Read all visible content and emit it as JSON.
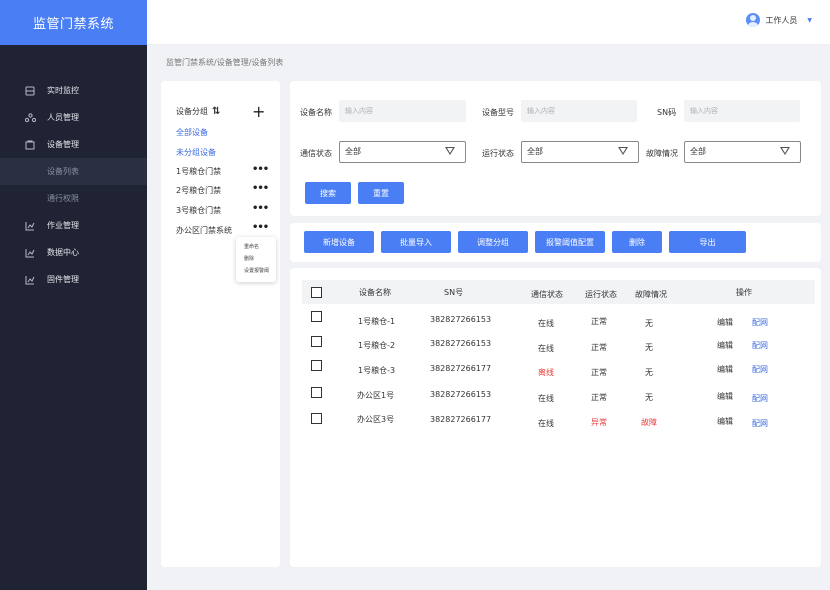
{
  "brand": "监管门禁系统",
  "user": {
    "name": "工作人员"
  },
  "breadcrumb": "监管门禁系统/设备管理/设备列表",
  "menu": [
    {
      "label": "实时监控",
      "icon": "monitor-icon"
    },
    {
      "label": "人员管理",
      "icon": "users-icon"
    },
    {
      "label": "设备管理",
      "icon": "device-icon"
    },
    {
      "label": "设备列表",
      "sub": true,
      "active": true
    },
    {
      "label": "通行权限",
      "sub": true
    },
    {
      "label": "作业管理",
      "icon": "chart-icon"
    },
    {
      "label": "数据中心",
      "icon": "chart-icon"
    },
    {
      "label": "固件管理",
      "icon": "chart-icon"
    }
  ],
  "tree": {
    "title": "设备分组",
    "items": [
      {
        "label": "全部设备",
        "link": true
      },
      {
        "label": "未分组设备",
        "link": true
      },
      {
        "label": "1号粮仓门禁",
        "more": true
      },
      {
        "label": "2号粮仓门禁",
        "more": true
      },
      {
        "label": "3号粮仓门禁",
        "more": true
      },
      {
        "label": "办公区门禁系统",
        "more": true
      }
    ],
    "context_menu": [
      "重命名",
      "删除",
      "设置报警阈"
    ]
  },
  "filters": {
    "device_name": {
      "label": "设备名称",
      "placeholder": "输入内容"
    },
    "device_model": {
      "label": "设备型号",
      "placeholder": "输入内容"
    },
    "sn": {
      "label": "SN码",
      "placeholder": "输入内容"
    },
    "comm_status": {
      "label": "通信状态",
      "value": "全部"
    },
    "run_status": {
      "label": "运行状态",
      "value": "全部"
    },
    "fault": {
      "label": "故障情况",
      "value": "全部"
    },
    "search_label": "搜索",
    "reset_label": "重置"
  },
  "actions": [
    "新增设备",
    "批量导入",
    "调整分组",
    "报警阈值配置",
    "删除",
    "导出"
  ],
  "table": {
    "headers": [
      "设备名称",
      "SN号",
      "通信状态",
      "运行状态",
      "故障情况",
      "操作"
    ],
    "rows": [
      {
        "name": "1号粮仓-1",
        "sn": "382827266153",
        "comm": "在线",
        "run": "正常",
        "fault": "无",
        "edit": "编辑",
        "config": "配网"
      },
      {
        "name": "1号粮仓-2",
        "sn": "382827266153",
        "comm": "在线",
        "run": "正常",
        "fault": "无",
        "edit": "编辑",
        "config": "配网"
      },
      {
        "name": "1号粮仓-3",
        "sn": "382827266177",
        "comm": "离线",
        "run": "正常",
        "fault": "无",
        "edit": "编辑",
        "config": "配网",
        "comm_alert": true
      },
      {
        "name": "办公区1号",
        "sn": "382827266153",
        "comm": "在线",
        "run": "正常",
        "fault": "无",
        "edit": "编辑",
        "config": "配网"
      },
      {
        "name": "办公区3号",
        "sn": "382827266177",
        "comm": "在线",
        "run": "异常",
        "fault": "故障",
        "edit": "编辑",
        "config": "配网",
        "run_alert": true,
        "fault_alert": true
      }
    ]
  }
}
